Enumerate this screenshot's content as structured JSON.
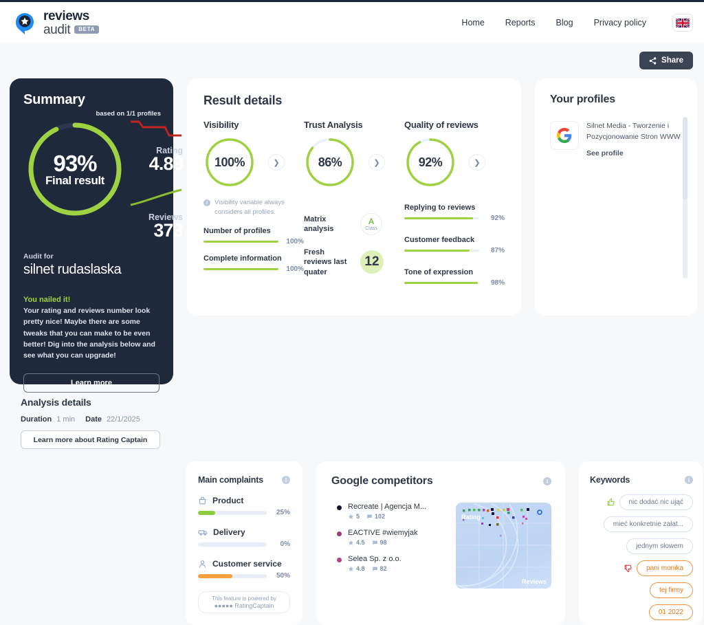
{
  "header": {
    "logo_reviews": "reviews",
    "logo_audit": "audit",
    "beta": "BETA",
    "nav": [
      {
        "label": "Home"
      },
      {
        "label": "Reports"
      },
      {
        "label": "Blog"
      },
      {
        "label": "Privacy policy"
      }
    ],
    "flag": "uk-flag-icon"
  },
  "share": {
    "label": "Share"
  },
  "summary": {
    "title": "Summary",
    "based_on": "based on 1/1 profiles",
    "final_pct": "93%",
    "final_caption": "Final result",
    "final_value": 93,
    "rating_label": "Rating",
    "rating_value": "4.89",
    "reviews_label": "Reviews",
    "reviews_value": "373",
    "audit_for_label": "Audit for",
    "audit_name": "silnet rudaslaska",
    "verdict": "You nailed it!",
    "description": "Your rating and reviews number look pretty nice! Maybe there are some tweaks that you can make to be even better! Dig into the analysis below and see what you can upgrade!",
    "learn_more": "Learn more",
    "accent_green": "#9fd243",
    "card_bg": "#1f293c"
  },
  "analysis": {
    "title": "Analysis details",
    "duration_label": "Duration",
    "duration_value": "1 min",
    "date_label": "Date",
    "date_value": "22/1/2025",
    "rc_button": "Learn more about Rating Captain"
  },
  "result_details": {
    "title": "Result details",
    "columns": [
      {
        "title": "Visibility",
        "pct": "100%",
        "value": 100,
        "note": "Visibility variable always considers all profiles.",
        "bars": [
          {
            "label": "Number of profiles",
            "pct": "100%",
            "value": 100
          },
          {
            "label": "Complete information",
            "pct": "100%",
            "value": 100
          }
        ]
      },
      {
        "title": "Trust Analysis",
        "pct": "86%",
        "value": 86,
        "matrix_label": "Matrix analysis",
        "matrix_class": "A",
        "matrix_class_text": "Class",
        "fresh_label": "Fresh reviews last quater",
        "fresh_value": "12"
      },
      {
        "title": "Quality of reviews",
        "pct": "92%",
        "value": 92,
        "bars": [
          {
            "label": "Replying to reviews",
            "pct": "92%",
            "value": 92
          },
          {
            "label": "Customer feedback",
            "pct": "87%",
            "value": 87
          },
          {
            "label": "Tone of expression",
            "pct": "98%",
            "value": 98
          }
        ]
      }
    ]
  },
  "profiles": {
    "title": "Your profiles",
    "items": [
      {
        "icon": "google-icon",
        "name": "Silnet Media - Tworzenie i Pozycjonowanie Stron WWW",
        "link": "See profile"
      }
    ]
  },
  "complaints": {
    "title": "Main complaints",
    "items": [
      {
        "icon": "basket-icon",
        "label": "Product",
        "pct": "25%",
        "value": 25,
        "color": "#8ccc3f"
      },
      {
        "icon": "truck-icon",
        "label": "Delivery",
        "pct": "0%",
        "value": 0,
        "color": "#8ccc3f"
      },
      {
        "icon": "person-icon",
        "label": "Customer service",
        "pct": "50%",
        "value": 50,
        "color": "#f5a03c"
      }
    ],
    "powered_line1": "This feature is powered by",
    "powered_line2": "RatingCaptain"
  },
  "competitors": {
    "title": "Google competitors",
    "items": [
      {
        "name": "Recreate | Agencja M...",
        "rating": "5",
        "reviews": "102",
        "color": "#171231"
      },
      {
        "name": "EACTIVE #wiemyjak",
        "rating": "4.5",
        "reviews": "98",
        "color": "#9c3a7a"
      },
      {
        "name": "Selea Sp. z o.o.",
        "rating": "4.8",
        "reviews": "82",
        "color": "#b4417f"
      }
    ],
    "chart_axis_y": "Rating",
    "chart_axis_x": "Reviews"
  },
  "keywords": {
    "title": "Keywords",
    "items": [
      {
        "text": "nic dodać nic ująć",
        "sentiment": "positive",
        "icon": "thumbs-up-icon"
      },
      {
        "text": "mieć konkretnie załat...",
        "sentiment": "neutral",
        "icon": ""
      },
      {
        "text": "jednym słowem",
        "sentiment": "neutral",
        "icon": ""
      },
      {
        "text": "pani monika",
        "sentiment": "negative",
        "icon": "thumbs-down-icon"
      },
      {
        "text": "tej firmy",
        "sentiment": "negative",
        "icon": ""
      },
      {
        "text": "01 2022",
        "sentiment": "negative",
        "icon": ""
      }
    ]
  }
}
